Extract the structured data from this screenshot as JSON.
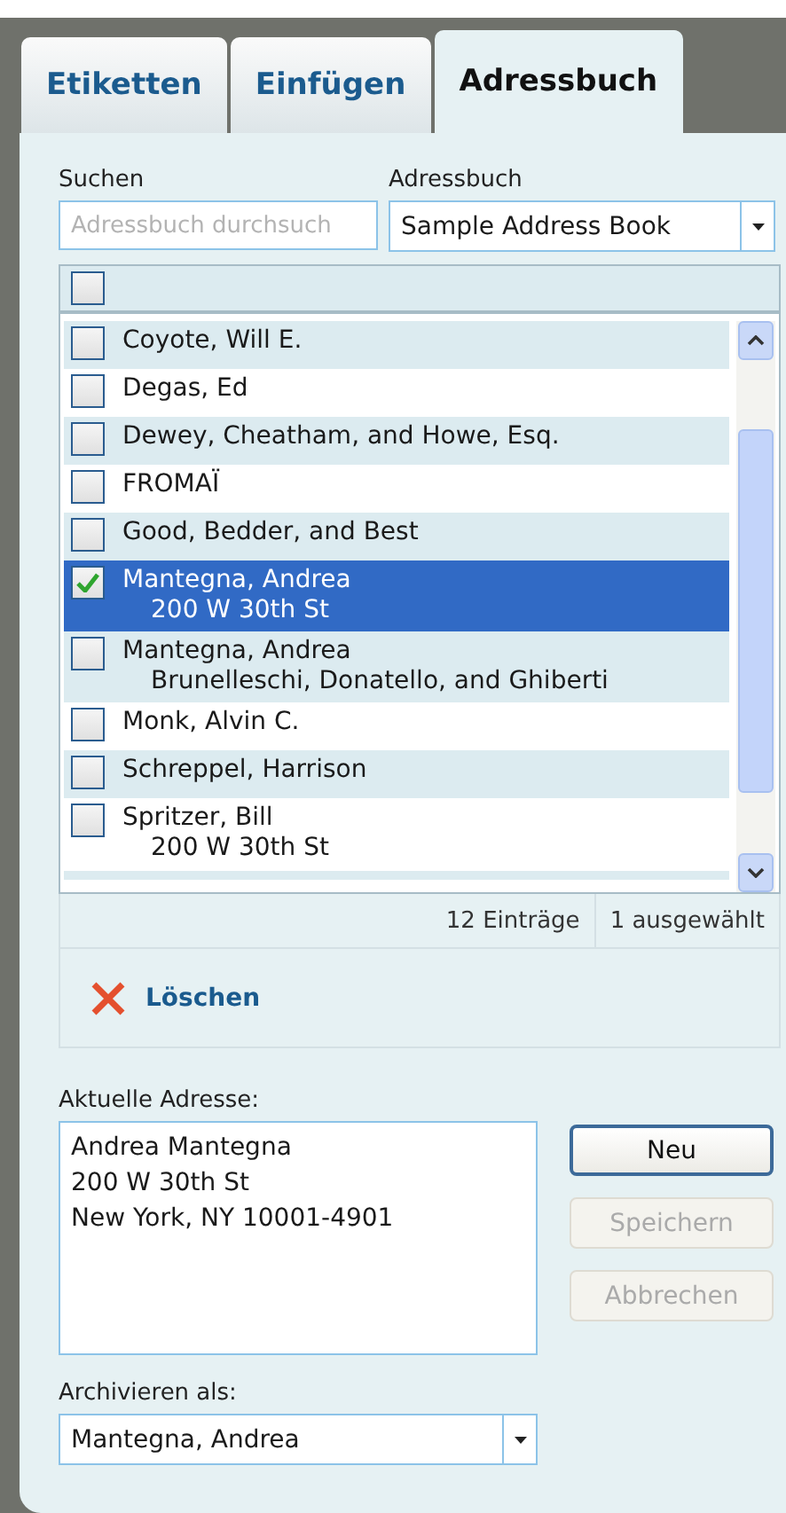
{
  "tabs": [
    {
      "label": "Etiketten",
      "selected": false
    },
    {
      "label": "Einfügen",
      "selected": false
    },
    {
      "label": "Adressbuch",
      "selected": true
    }
  ],
  "search": {
    "label": "Suchen",
    "placeholder": "Adressbuch durchsuch"
  },
  "address_book": {
    "label": "Adressbuch",
    "value": "Sample Address Book"
  },
  "list": {
    "select_all_checked": false,
    "rows": [
      {
        "name": "Coyote, Will E.",
        "checked": false,
        "selected": false
      },
      {
        "name": "Degas, Ed",
        "checked": false,
        "selected": false
      },
      {
        "name": "Dewey, Cheatham, and Howe, Esq.",
        "checked": false,
        "selected": false
      },
      {
        "name": "FROMAÏ",
        "checked": false,
        "selected": false
      },
      {
        "name": "Good, Bedder, and Best",
        "checked": false,
        "selected": false
      },
      {
        "name": "Mantegna, Andrea",
        "detail": "200 W 30th St",
        "checked": true,
        "selected": true
      },
      {
        "name": "Mantegna, Andrea",
        "detail": "Brunelleschi, Donatello, and Ghiberti",
        "checked": false,
        "selected": false
      },
      {
        "name": "Monk, Alvin C.",
        "checked": false,
        "selected": false
      },
      {
        "name": "Schreppel, Harrison",
        "checked": false,
        "selected": false
      },
      {
        "name": "Spritzer, Bill",
        "detail": "200 W 30th St",
        "checked": false,
        "selected": false
      }
    ]
  },
  "status": {
    "count": "12 Einträge",
    "selected": "1 ausgewählt"
  },
  "delete_button": "Löschen",
  "current_address": {
    "label": "Aktuelle Adresse:",
    "lines": [
      "Andrea Mantegna",
      "200 W 30th St",
      "New York, NY 10001-4901"
    ]
  },
  "buttons": [
    {
      "label": "Neu",
      "disabled": false
    },
    {
      "label": "Speichern",
      "disabled": true
    },
    {
      "label": "Abbrechen",
      "disabled": true
    }
  ],
  "file_as": {
    "label": "Archivieren als:",
    "value": "Mantegna, Andrea"
  }
}
